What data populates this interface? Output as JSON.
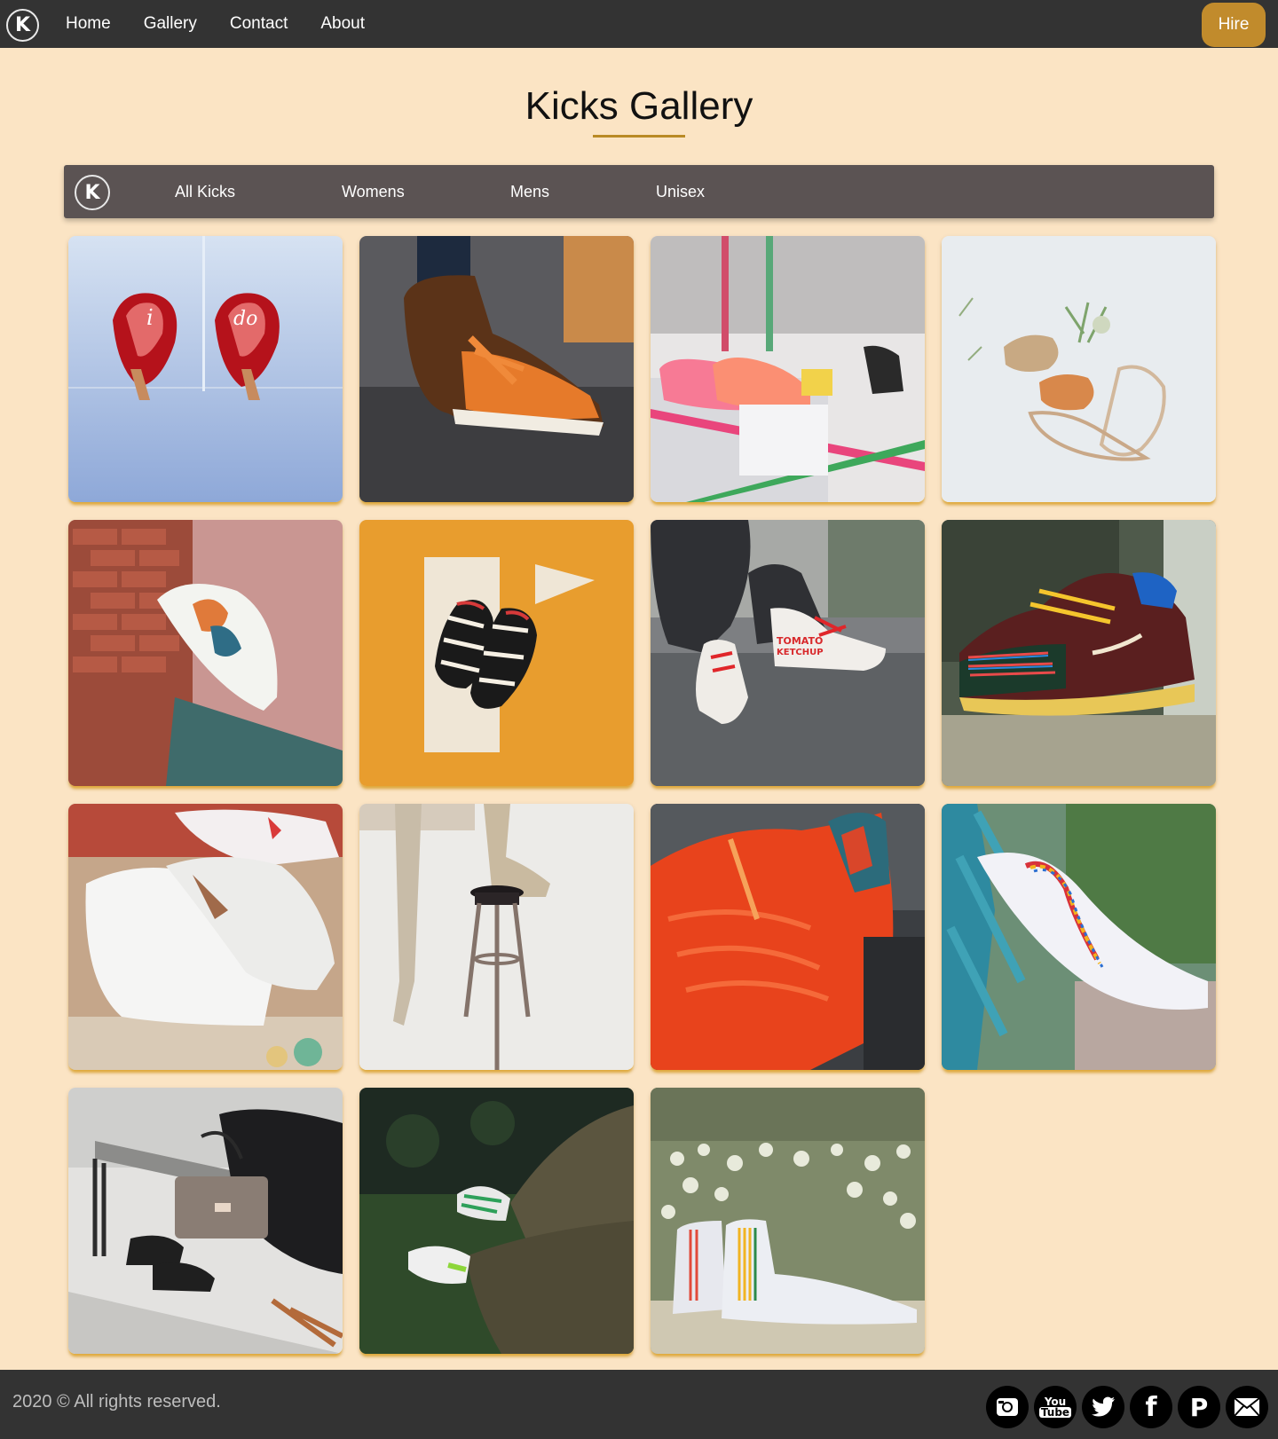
{
  "nav": {
    "logo_letter": "K",
    "links": [
      "Home",
      "Gallery",
      "Contact",
      "About"
    ],
    "hire_label": "Hire"
  },
  "page": {
    "title": "Kicks Gallery"
  },
  "filters": {
    "logo_letter": "K",
    "tabs": [
      "All Kicks",
      "Womens",
      "Mens",
      "Unisex"
    ]
  },
  "gallery": {
    "items": [
      {
        "subject": "red-heels-i-do"
      },
      {
        "subject": "brown-orange-high-top"
      },
      {
        "subject": "painted-sneakers-on-box"
      },
      {
        "subject": "strappy-sandals-flat-lay"
      },
      {
        "subject": "painted-white-sneaker-on-brick-wall"
      },
      {
        "subject": "zebra-sneakers-on-yellow"
      },
      {
        "subject": "tomato-ketchup-sneakers"
      },
      {
        "subject": "multicolor-dunk-low"
      },
      {
        "subject": "custom-white-sneakers"
      },
      {
        "subject": "boots-on-stool"
      },
      {
        "subject": "orange-running-shoe"
      },
      {
        "subject": "white-puma-sneaker"
      },
      {
        "subject": "boots-with-handbag-on-bench"
      },
      {
        "subject": "sneakers-on-grass"
      },
      {
        "subject": "white-high-tops-with-flowers"
      }
    ]
  },
  "footer": {
    "copyright": "2020 © All rights reserved.",
    "socials": [
      "instagram-icon",
      "youtube-icon",
      "twitter-icon",
      "facebook-icon",
      "pinterest-icon",
      "mail-icon"
    ],
    "youtube_top": "You",
    "youtube_bottom": "Tube",
    "facebook_glyph": "f",
    "pinterest_glyph": "P"
  },
  "colors": {
    "page_bg": "#fbe4c4",
    "nav_bg": "#333333",
    "filter_bar_bg": "#5b5353",
    "accent": "#c18b2c"
  }
}
